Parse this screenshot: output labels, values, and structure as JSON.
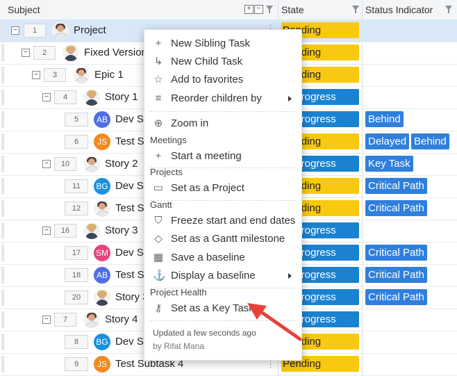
{
  "header": {
    "subject": "Subject",
    "state": "State",
    "status_indicator": "Status Indicator",
    "expand_all": "+",
    "collapse_all": "−"
  },
  "rows": [
    {
      "num": "1",
      "title": "Project",
      "state": "Pending",
      "avatar": "photo-dark",
      "tags": []
    },
    {
      "num": "2",
      "title": "Fixed Version",
      "state": "Pending",
      "avatar": "photo-light",
      "tags": []
    },
    {
      "num": "3",
      "title": "Epic 1",
      "state": "Pending",
      "avatar": "photo-dark",
      "tags": []
    },
    {
      "num": "4",
      "title": "Story 1",
      "state": "In Progress",
      "avatar": "photo-light",
      "tags": []
    },
    {
      "num": "5",
      "title": "Dev Subtask 1",
      "state": "In Progress",
      "avatar": "AB",
      "tags": [
        "Behind"
      ]
    },
    {
      "num": "6",
      "title": "Test Subtask 1",
      "state": "Pending",
      "avatar": "JS",
      "tags": [
        "Delayed",
        "Behind"
      ]
    },
    {
      "num": "10",
      "title": "Story 2",
      "state": "In Progress",
      "avatar": "photo-dark",
      "tags": [
        "Key Task"
      ]
    },
    {
      "num": "11",
      "title": "Dev Subtask 2",
      "state": "Pending",
      "avatar": "BG",
      "tags": [
        "Critical Path"
      ]
    },
    {
      "num": "12",
      "title": "Test Subtask 2",
      "state": "Pending",
      "avatar": "photo-dark",
      "tags": [
        "Critical Path"
      ]
    },
    {
      "num": "16",
      "title": "Story 3",
      "state": "In Progress",
      "avatar": "photo-light",
      "tags": []
    },
    {
      "num": "17",
      "title": "Dev Subtask 3",
      "state": "In Progress",
      "avatar": "SM",
      "tags": [
        "Critical Path"
      ]
    },
    {
      "num": "18",
      "title": "Test Subtask 3",
      "state": "In Progress",
      "avatar": "AB",
      "tags": [
        "Critical Path"
      ]
    },
    {
      "num": "20",
      "title": "Story 3 Milestone",
      "state": "In Progress",
      "avatar": "photo-light",
      "tags": [
        "Critical Path"
      ]
    },
    {
      "num": "7",
      "title": "Story 4",
      "state": "In Progress",
      "avatar": "photo-dark",
      "tags": []
    },
    {
      "num": "8",
      "title": "Dev Subtask 4",
      "state": "Pending",
      "avatar": "BG",
      "tags": []
    },
    {
      "num": "9",
      "title": "Test Subtask 4",
      "state": "Pending",
      "avatar": "JS",
      "tags": []
    }
  ],
  "avatar_colors": {
    "AB": "#4f6fe0",
    "JS": "#f28a1f",
    "BG": "#1a90e0",
    "SM": "#e8437a"
  },
  "state_colors": {
    "Pending": "#f8c910",
    "In Progress": "#1a82d0"
  },
  "tag_color": "#2f7fdc",
  "menu": {
    "items": [
      {
        "label": "New Sibling Task",
        "icon": "plus-icon"
      },
      {
        "label": "New Child Task",
        "icon": "child-arrow-icon"
      },
      {
        "label": "Add to favorites",
        "icon": "star-icon"
      },
      {
        "label": "Reorder children by",
        "icon": "reorder-icon",
        "submenu": true
      },
      {
        "label": "Zoom in",
        "icon": "zoom-in-icon"
      },
      {
        "label": "Start a meeting",
        "icon": "plus-icon"
      },
      {
        "label": "Set as a Project",
        "icon": "folder-icon"
      },
      {
        "label": "Freeze start and end dates",
        "icon": "shield-icon"
      },
      {
        "label": "Set as a Gantt milestone",
        "icon": "diamond-icon"
      },
      {
        "label": "Save a baseline",
        "icon": "calendar-icon"
      },
      {
        "label": "Display a baseline",
        "icon": "anchor-icon",
        "submenu": true
      },
      {
        "label": "Set as a Key Task",
        "icon": "key-icon"
      }
    ],
    "sections": {
      "meetings": "Meetings",
      "projects": "Projects",
      "gantt": "Gantt",
      "health": "Project Health"
    },
    "footer": {
      "updated": "Updated a few seconds ago",
      "by": "by Rifat Mana"
    }
  },
  "annotation": {
    "arrow_color": "#e8403a"
  }
}
